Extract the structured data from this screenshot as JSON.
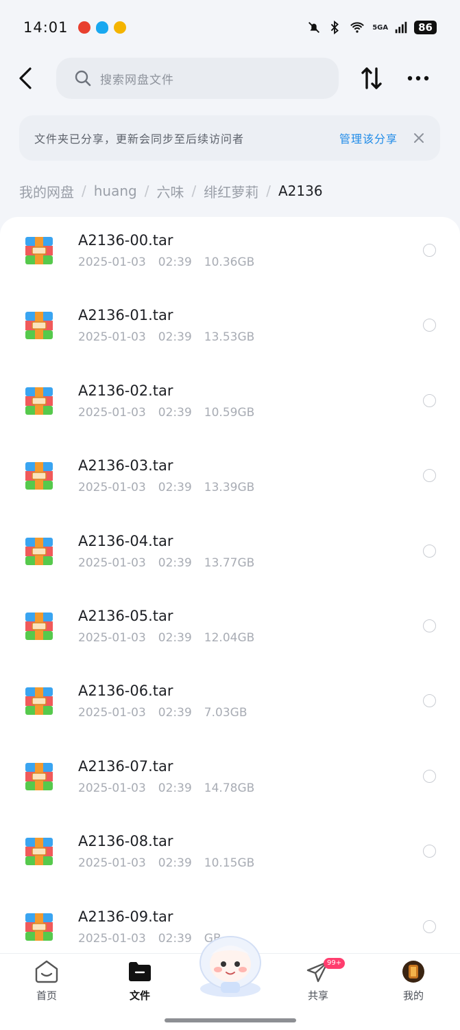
{
  "status": {
    "time": "14:01",
    "network": "5GA",
    "battery": "86"
  },
  "header": {
    "search_placeholder": "搜索网盘文件"
  },
  "share_banner": {
    "text": "文件夹已分享，更新会同步至后续访问者",
    "link": "管理该分享"
  },
  "breadcrumb": [
    "我的网盘",
    "huang",
    "六味",
    "绯红萝莉",
    "A2136"
  ],
  "files": [
    {
      "name": "A2136-00.tar",
      "date": "2025-01-03",
      "time": "02:39",
      "size": "10.36GB"
    },
    {
      "name": "A2136-01.tar",
      "date": "2025-01-03",
      "time": "02:39",
      "size": "13.53GB"
    },
    {
      "name": "A2136-02.tar",
      "date": "2025-01-03",
      "time": "02:39",
      "size": "10.59GB"
    },
    {
      "name": "A2136-03.tar",
      "date": "2025-01-03",
      "time": "02:39",
      "size": "13.39GB"
    },
    {
      "name": "A2136-04.tar",
      "date": "2025-01-03",
      "time": "02:39",
      "size": "13.77GB"
    },
    {
      "name": "A2136-05.tar",
      "date": "2025-01-03",
      "time": "02:39",
      "size": "12.04GB"
    },
    {
      "name": "A2136-06.tar",
      "date": "2025-01-03",
      "time": "02:39",
      "size": "7.03GB"
    },
    {
      "name": "A2136-07.tar",
      "date": "2025-01-03",
      "time": "02:39",
      "size": "14.78GB"
    },
    {
      "name": "A2136-08.tar",
      "date": "2025-01-03",
      "time": "02:39",
      "size": "10.15GB"
    },
    {
      "name": "A2136-09.tar",
      "date": "2025-01-03",
      "time": "02:39",
      "size": "GB"
    }
  ],
  "tabs": [
    {
      "label": "首页",
      "icon": "home-icon"
    },
    {
      "label": "文件",
      "icon": "folder-icon"
    },
    {
      "label": "共享",
      "icon": "paper-plane-icon",
      "badge": "99+"
    },
    {
      "label": "我的",
      "icon": "avatar"
    }
  ],
  "colors": {
    "accent": "#1f8be8",
    "badge": "#ff3d6e",
    "archive_top": "#3aa4f0",
    "archive_mid": "#f05a5a",
    "archive_bottom": "#56c94c",
    "archive_band": "#f39a2e"
  }
}
